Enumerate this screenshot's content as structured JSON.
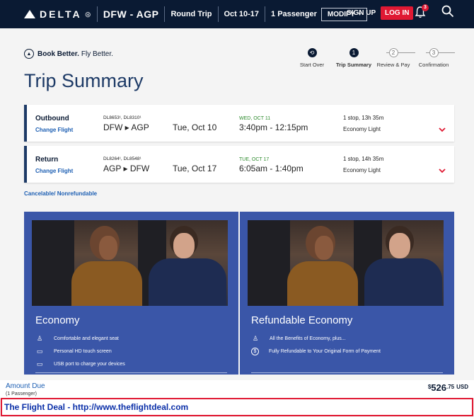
{
  "topbar": {
    "logo_text": "DELTA",
    "route": "DFW - AGP",
    "trip_type": "Round Trip",
    "dates": "Oct 10-17",
    "passengers": "1 Passenger",
    "modify_label": "MODIFY",
    "signup_label": "SIGN UP",
    "login_label": "LOG IN",
    "notification_count": "3"
  },
  "header": {
    "tagline_bold": "Book Better.",
    "tagline_rest": "Fly Better.",
    "title": "Trip Summary"
  },
  "steps": [
    {
      "label": "Start Over",
      "num": ""
    },
    {
      "label": "Trip Summary",
      "num": "1"
    },
    {
      "label": "Review & Pay",
      "num": "2"
    },
    {
      "label": "Confirmation",
      "num": "3"
    }
  ],
  "flights": [
    {
      "direction": "Outbound",
      "change_label": "Change Flight",
      "flight_numbers": "DL8653¹, DL8310¹",
      "route": "DFW ▸ AGP",
      "date": "Tue, Oct 10",
      "arrival_day": "WED, OCT 11",
      "time": "3:40pm - 12:15pm",
      "stops": "1 stop, 13h 35m",
      "cabin": "Economy Light"
    },
    {
      "direction": "Return",
      "change_label": "Change Flight",
      "flight_numbers": "DL8264¹, DL8548¹",
      "route": "AGP ▸ DFW",
      "date": "Tue, Oct 17",
      "arrival_day": "TUE, OCT 17",
      "time": "6:05am - 1:40pm",
      "stops": "1 stop, 14h 35m",
      "cabin": "Economy Light"
    }
  ],
  "cancelable_text": "Cancelable/ Nonrefundable",
  "fares": [
    {
      "title": "Economy",
      "features": [
        {
          "icon": "seat-icon",
          "text": "Comfortable and elegant seat"
        },
        {
          "icon": "screen-icon",
          "text": "Personal HD touch screen"
        },
        {
          "icon": "usb-icon",
          "text": "USB port to charge your devices"
        }
      ]
    },
    {
      "title": "Refundable Economy",
      "features": [
        {
          "icon": "seat-icon",
          "text": "All the Benefits of Economy, plus..."
        },
        {
          "icon": "dollar-icon",
          "text": "Fully Refundable to Your Original Form of Payment"
        }
      ]
    }
  ],
  "amount": {
    "label": "Amount Due",
    "sub": "(1 Passenger)",
    "currency_symbol": "$",
    "dollars": "526",
    "cents": ".75",
    "currency": "USD"
  },
  "footer": {
    "text": "The Flight Deal - http://www.theflightdeal.com"
  },
  "colors": {
    "navy": "#0a1a33",
    "accent_red": "#e01933",
    "link_blue": "#1d5fb3",
    "fare_blue": "#3a56a8"
  }
}
